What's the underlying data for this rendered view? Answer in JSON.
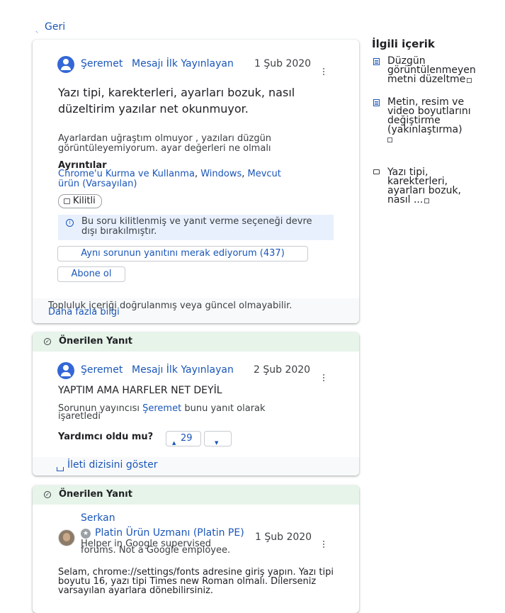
{
  "nav": {
    "back_label": "Geri"
  },
  "question": {
    "author": "Şeremet",
    "author_badge": "Mesajı İlk Yayınlayan",
    "date": "1 Şub 2020",
    "title": "Yazı tipi, karekterleri, ayarları bozuk, nasıl düzeltirim yazılar net okunmuyor.",
    "body": "Ayarlardan uğraştım olmuyor , yazıları düzgün görüntüleyemiyorum. ayar değerleri ne olmalı",
    "details_heading": "Ayrıntılar",
    "details_link1": "Chrome'u Kurma ve Kullanma",
    "details_link2": "Windows",
    "details_link3": "Mevcut ürün (Varsayılan)",
    "locked_chip": "Kilitli",
    "locked_notice": "Bu soru kilitlenmiş ve yanıt verme seçeneği devre dışı bırakılmıştır.",
    "same_question_button": "Aynı sorunun yanıtını merak ediyorum (437)",
    "subscribe_button": "Abone ol",
    "footer_text": "Topluluk içeriği doğrulanmış veya güncel olmayabilir.",
    "footer_link": "Daha fazla bilgi"
  },
  "answer1": {
    "header": "Önerilen Yanıt",
    "author": "Şeremet",
    "author_badge": "Mesajı İlk Yayınlayan",
    "date": "2 Şub 2020",
    "body": "YAPTIM AMA HARFLER NET DEYİL",
    "marked_prefix": "Sorunun yayıncısı ",
    "marked_author": "Şeremet",
    "marked_suffix": " bunu yanıt olarak işaretledi",
    "helpful_label": "Yardımcı oldu mu?",
    "upvotes": "29",
    "thread_link": "İleti dizisini göster"
  },
  "answer2": {
    "header": "Önerilen Yanıt",
    "author": "Serkan",
    "author_title": "Platin Ürün Uzmanı (Platin PE)",
    "date": "1 Şub 2020",
    "helper_note": "Helper in Google supervised forums. Not a Google employee.",
    "body": "Selam, chrome://settings/fonts adresine giriş yapın. Yazı tipi boyutu 16, yazı tipi Times new Roman olmalı. Dilerseniz varsayılan ayarlara dönebilirsiniz."
  },
  "sidebar": {
    "title": "İlgili içerik",
    "items": [
      {
        "label": "Düzgün görüntülenmeyen metni düzeltme",
        "icon": "doc-icon"
      },
      {
        "label": "Metin, resim ve video boyutlarını değiştirme (yakınlaştırma)",
        "icon": "doc-icon"
      },
      {
        "label": "Yazı tipi, karekterleri, ayarları bozuk, nasıl ...",
        "icon": "forum-icon"
      }
    ]
  },
  "colors": {
    "link": "#1a56b8",
    "accent_green_bg": "#e6f4ea",
    "info_bg": "#e8f0fe"
  }
}
